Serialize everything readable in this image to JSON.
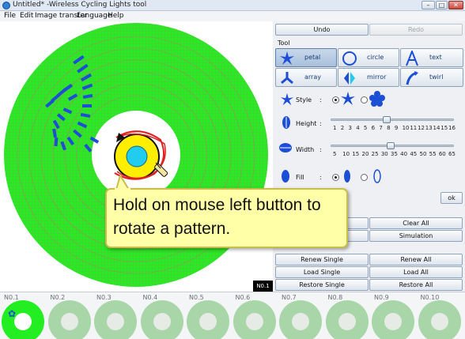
{
  "window": {
    "title": "Untitled* -Wireless Cycling Lights tool",
    "minimize": "–",
    "maximize": "□",
    "close": "✕"
  },
  "menu": {
    "file": "File",
    "edit": "Edit",
    "image_transfer": "Image transfer",
    "language": "Language",
    "help": "Help"
  },
  "history": {
    "undo": "Undo",
    "redo": "Redo"
  },
  "tool": {
    "section": "Tool",
    "buttons": [
      {
        "label": "petal",
        "icon": "petal-star-icon"
      },
      {
        "label": "circle",
        "icon": "circle-icon"
      },
      {
        "label": "text",
        "icon": "letter-a-icon"
      },
      {
        "label": "array",
        "icon": "array-icon"
      },
      {
        "label": "mirror",
        "icon": "mirror-icon"
      },
      {
        "label": "twirl",
        "icon": "twirl-icon"
      }
    ],
    "selected": "petal"
  },
  "style": {
    "label": "Style",
    "sep": ":",
    "selected": "sharp-star"
  },
  "height": {
    "label": "Height",
    "sep": ":",
    "ticks": [
      "1",
      "2",
      "3",
      "4",
      "5",
      "6",
      "7",
      "8",
      "9",
      "10",
      "11",
      "12",
      "13",
      "14",
      "15",
      "16"
    ],
    "value": 8
  },
  "width": {
    "label": "Width",
    "sep": ":",
    "ticks": [
      "5",
      "10",
      "15",
      "20",
      "25",
      "30",
      "35",
      "40",
      "45",
      "50",
      "55",
      "60",
      "65"
    ],
    "value": 35
  },
  "fill": {
    "label": "Fill",
    "sep": ":",
    "selected": "solid"
  },
  "ok": "ok",
  "actions": {
    "clear_all": "Clear All",
    "simulation": "Simulation",
    "renew_single": "Renew Single",
    "renew_all": "Renew All",
    "load_single": "Load Single",
    "load_all": "Load All",
    "restore_single": "Restore Single",
    "restore_all": "Restore All"
  },
  "current_slot_tag": "N0.1",
  "slots": [
    "N0.1",
    "N0.2",
    "N0.3",
    "N0.4",
    "N0.5",
    "N0.6",
    "N0.7",
    "N0.8",
    "N0.9",
    "N0.10"
  ],
  "tooltip": {
    "line1": "Hold on mouse left button to",
    "line2": "rotate a pattern."
  },
  "colors": {
    "wheel": "#22ee22",
    "pattern": "#1d4fd6",
    "tooltip_bg": "#ffffa8",
    "rotate_arrow": "#e02020",
    "hub": "#ffee00"
  }
}
